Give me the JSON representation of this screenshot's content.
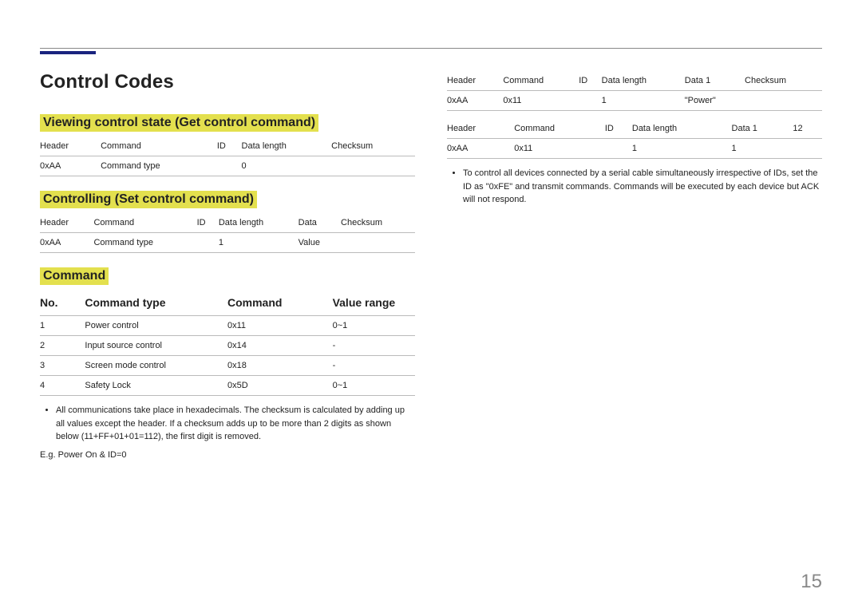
{
  "page_title": "Control Codes",
  "page_number": "15",
  "left": {
    "section1_heading": "Viewing control state (Get control command)",
    "table1": {
      "headers": [
        "Header",
        "Command",
        "ID",
        "Data length",
        "Checksum"
      ],
      "row": [
        "0xAA",
        "Command type",
        "",
        "0",
        ""
      ]
    },
    "section2_heading": "Controlling (Set control command)",
    "table2": {
      "headers": [
        "Header",
        "Command",
        "ID",
        "Data length",
        "Data",
        "Checksum"
      ],
      "row": [
        "0xAA",
        "Command type",
        "",
        "1",
        "Value",
        ""
      ]
    },
    "section3_heading": "Command",
    "cmd_headers": {
      "no": "No.",
      "type": "Command type",
      "cmd": "Command",
      "range": "Value range"
    },
    "commands": [
      {
        "no": "1",
        "type": "Power control",
        "cmd": "0x11",
        "range": "0~1"
      },
      {
        "no": "2",
        "type": "Input source control",
        "cmd": "0x14",
        "range": "-"
      },
      {
        "no": "3",
        "type": "Screen mode control",
        "cmd": "0x18",
        "range": "-"
      },
      {
        "no": "4",
        "type": "Safety Lock",
        "cmd": "0x5D",
        "range": "0~1"
      }
    ],
    "bullet": "All communications take place in hexadecimals. The checksum is calculated by adding up all values except the header. If a checksum adds up to be more than 2 digits as shown below (11+FF+01+01=112), the first digit is removed.",
    "eg": "E.g. Power On & ID=0"
  },
  "right": {
    "table1": {
      "headers": [
        "Header",
        "Command",
        "ID",
        "Data length",
        "Data 1",
        "Checksum"
      ],
      "row": [
        "0xAA",
        "0x11",
        "",
        "1",
        "\"Power\"",
        ""
      ]
    },
    "table2": {
      "headers": [
        "Header",
        "Command",
        "ID",
        "Data length",
        "Data 1",
        "12"
      ],
      "row": [
        "0xAA",
        "0x11",
        "",
        "1",
        "1",
        ""
      ]
    },
    "bullet": "To control all devices connected by a serial cable simultaneously irrespective of IDs, set the ID as \"0xFE\" and transmit commands. Commands will be executed by each device but ACK will not respond."
  }
}
